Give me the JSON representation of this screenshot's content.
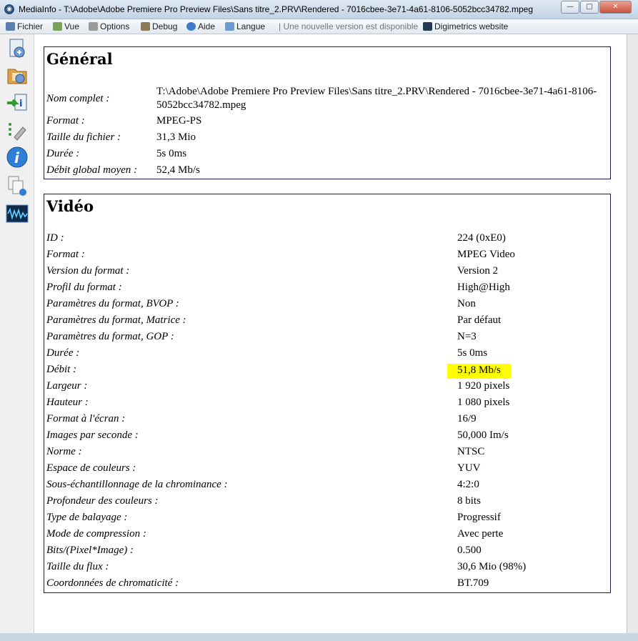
{
  "window": {
    "title": "MediaInfo - T:\\Adobe\\Adobe Premiere Pro Preview Files\\Sans titre_2.PRV\\Rendered - 7016cbee-3e71-4a61-8106-5052bcc34782.mpeg",
    "min_glyph": "—",
    "max_glyph": "□",
    "close_glyph": "✕"
  },
  "menu": {
    "fichier": "Fichier",
    "vue": "Vue",
    "options": "Options",
    "debug": "Debug",
    "aide": "Aide",
    "langue": "Langue",
    "update_notice": "| Une nouvelle version est disponible",
    "website": "Digimetrics website"
  },
  "sidebar": [
    "open-file-icon",
    "open-folder-icon",
    "export-icon",
    "settings-icon",
    "info-icon",
    "copy-icon",
    "waveform-icon"
  ],
  "general": {
    "title": "Général",
    "rows": [
      {
        "key": "Nom complet :",
        "value": "T:\\Adobe\\Adobe Premiere Pro Preview Files\\Sans titre_2.PRV\\Rendered - 7016cbee-3e71-4a61-8106-5052bcc34782.mpeg"
      },
      {
        "key": "Format :",
        "value": "MPEG-PS"
      },
      {
        "key": "Taille du fichier :",
        "value": "31,3 Mio"
      },
      {
        "key": "Durée :",
        "value": "5s 0ms"
      },
      {
        "key": "Débit global moyen :",
        "value": "52,4 Mb/s"
      }
    ]
  },
  "video": {
    "title": "Vidéo",
    "rows": [
      {
        "key": "ID :",
        "value": "224 (0xE0)"
      },
      {
        "key": "Format :",
        "value": "MPEG Video"
      },
      {
        "key": "Version du format :",
        "value": "Version 2"
      },
      {
        "key": "Profil du format :",
        "value": "High@High"
      },
      {
        "key": "Paramètres du format, BVOP :",
        "value": "Non"
      },
      {
        "key": "Paramètres du format, Matrice :",
        "value": "Par défaut"
      },
      {
        "key": "Paramètres du format, GOP :",
        "value": "N=3"
      },
      {
        "key": "Durée :",
        "value": "5s 0ms"
      },
      {
        "key": "Débit :",
        "value": "51,8 Mb/s"
      },
      {
        "key": "Largeur :",
        "value": "1 920 pixels"
      },
      {
        "key": "Hauteur :",
        "value": "1 080 pixels"
      },
      {
        "key": "Format à l'écran :",
        "value": "16/9"
      },
      {
        "key": "Images par seconde :",
        "value": "50,000 Im/s"
      },
      {
        "key": "Norme :",
        "value": "NTSC"
      },
      {
        "key": "Espace de couleurs :",
        "value": "YUV"
      },
      {
        "key": "Sous-échantillonnage de la chrominance :",
        "value": "4:2:0"
      },
      {
        "key": "Profondeur des couleurs :",
        "value": "8 bits"
      },
      {
        "key": "Type de balayage :",
        "value": "Progressif"
      },
      {
        "key": "Mode de compression :",
        "value": "Avec perte"
      },
      {
        "key": "Bits/(Pixel*Image) :",
        "value": "0.500"
      },
      {
        "key": "Taille du flux :",
        "value": "30,6 Mio (98%)"
      },
      {
        "key": "Coordonnées de chromaticité :",
        "value": "BT.709"
      }
    ]
  },
  "colors": {
    "highlight": "#ffff00",
    "section_border": "#1a1a55"
  }
}
